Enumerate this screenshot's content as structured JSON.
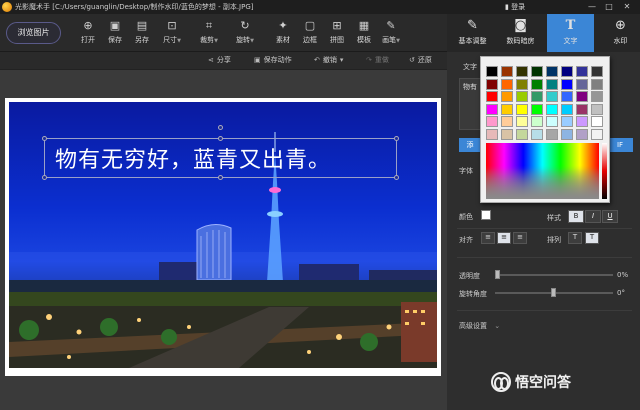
{
  "titlebar": {
    "app_name": "光影魔术手",
    "path": "[C:/Users/guanglin/Desktop/制作水印/蓝色的梦想 - 副本.JPG]",
    "login": "登录",
    "min": "—",
    "max": "□",
    "close": "✕"
  },
  "toolbar": {
    "browse": "浏览图片",
    "tools": [
      {
        "label": "打开",
        "icon": "open-icon"
      },
      {
        "label": "保存",
        "icon": "save-icon"
      },
      {
        "label": "另存",
        "icon": "save-as-icon"
      },
      {
        "label": "尺寸",
        "icon": "resize-icon"
      },
      {
        "label": "裁剪",
        "icon": "crop-icon"
      },
      {
        "label": "旋转",
        "icon": "rotate-icon"
      },
      {
        "label": "素材",
        "icon": "material-icon"
      },
      {
        "label": "边框",
        "icon": "border-icon"
      },
      {
        "label": "拼图",
        "icon": "puzzle-icon"
      },
      {
        "label": "模板",
        "icon": "template-icon"
      },
      {
        "label": "画笔",
        "icon": "brush-icon"
      }
    ]
  },
  "right_tabs": [
    {
      "label": "基本调整",
      "icon": "adjust-icon"
    },
    {
      "label": "数码暗房",
      "icon": "darkroom-icon"
    },
    {
      "label": "文字",
      "icon": "text-icon",
      "active": true
    },
    {
      "label": "水印",
      "icon": "watermark-icon"
    }
  ],
  "subbar": {
    "share": "分享",
    "save_action": "保存动作",
    "undo": "撤销",
    "redo": "重做",
    "restore": "还原"
  },
  "canvas": {
    "overlay_text": "物有无穷好，蓝青又出青。"
  },
  "panel": {
    "section_title": "文字",
    "text_value": "物有",
    "add_btn": "添",
    "tif_btn": "IF",
    "font_label": "字体",
    "color_label": "颜色",
    "style_label": "样式",
    "align_label": "对齐",
    "arrange_label": "排列",
    "transparency_label": "透明度",
    "transparency_value": "0%",
    "rotation_label": "旋转角度",
    "rotation_value": "0°",
    "advanced": "高级设置",
    "bold": "B",
    "italic": "I",
    "underline": "U",
    "arrange_v": "T",
    "arrange_h": "T"
  },
  "picker": {
    "swatches": [
      "#000000",
      "#993300",
      "#333300",
      "#003300",
      "#003366",
      "#000080",
      "#333399",
      "#333333",
      "#800000",
      "#ff6600",
      "#808000",
      "#008000",
      "#008080",
      "#0000ff",
      "#666699",
      "#808080",
      "#ff0000",
      "#ff9900",
      "#99cc00",
      "#339966",
      "#33cccc",
      "#3366ff",
      "#800080",
      "#969696",
      "#ff00ff",
      "#ffcc00",
      "#ffff00",
      "#00ff00",
      "#00ffff",
      "#00ccff",
      "#993366",
      "#c0c0c0",
      "#ff99cc",
      "#ffcc99",
      "#ffff99",
      "#ccffcc",
      "#ccffff",
      "#99ccff",
      "#cc99ff",
      "#ffffff",
      "#e6b9b8",
      "#d9c3a5",
      "#c4d79b",
      "#b7dee8",
      "#a6a6a6",
      "#8db4e2",
      "#b1a0c7",
      "#f2f2f2"
    ]
  },
  "brand": {
    "text": "悟空问答"
  }
}
